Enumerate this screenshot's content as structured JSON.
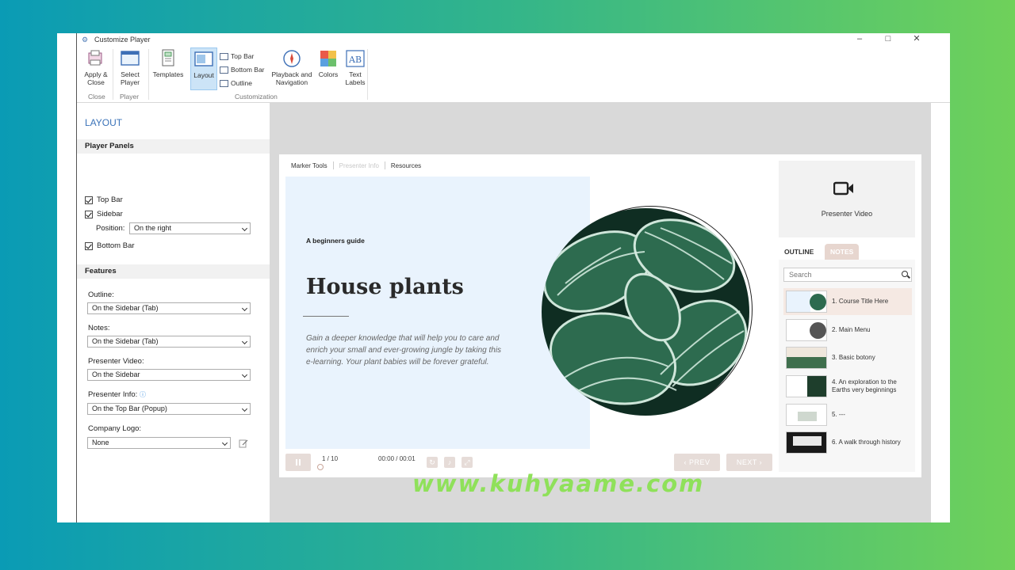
{
  "window": {
    "title": "Customize Player"
  },
  "ribbon": {
    "apply_close": "Apply & Close",
    "select_player": "Select Player",
    "templates": "Templates",
    "layout": "Layout",
    "top_bar": "Top Bar",
    "bottom_bar": "Bottom Bar",
    "outline": "Outline",
    "playback_navigation": "Playback and Navigation",
    "colors": "Colors",
    "text_labels": "Text Labels",
    "groups": {
      "close": "Close",
      "player": "Player",
      "customization": "Customization"
    }
  },
  "panel": {
    "title": "LAYOUT",
    "player_panels": {
      "heading": "Player Panels",
      "top_bar": "Top Bar",
      "sidebar": "Sidebar",
      "position_label": "Position:",
      "position_value": "On the right",
      "bottom_bar": "Bottom Bar"
    },
    "features": {
      "heading": "Features",
      "outline_label": "Outline:",
      "outline_value": "On the Sidebar (Tab)",
      "notes_label": "Notes:",
      "notes_value": "On the Sidebar (Tab)",
      "presenter_video_label": "Presenter Video:",
      "presenter_video_value": "On the Sidebar",
      "presenter_info_label": "Presenter Info:",
      "presenter_info_value": "On the Top Bar (Popup)",
      "company_logo_label": "Company Logo:",
      "company_logo_value": "None"
    }
  },
  "player": {
    "top_tabs": [
      "Marker Tools",
      "Presenter Info",
      "Resources"
    ],
    "slide": {
      "subtitle": "A beginners guide",
      "title": "House plants",
      "body": "Gain a deeper knowledge that will help you to care and enrich your small and ever-growing jungle by taking this e-learning. Your plant babies will be forever grateful."
    },
    "controls": {
      "slide_counter": "1 / 10",
      "time": "00:00 / 00:01",
      "prev": "PREV",
      "next": "NEXT"
    },
    "sidebar": {
      "presenter_video": "Presenter Video",
      "tab_outline": "OUTLINE",
      "tab_notes": "NOTES",
      "search_placeholder": "Search",
      "items": [
        "1. Course Title Here",
        "2. Main Menu",
        "3. Basic botony",
        "4. An exploration to the Earths very beginnings",
        "5. ---",
        "6. A walk through history"
      ]
    }
  },
  "watermark": "www.kuhyaame.com"
}
